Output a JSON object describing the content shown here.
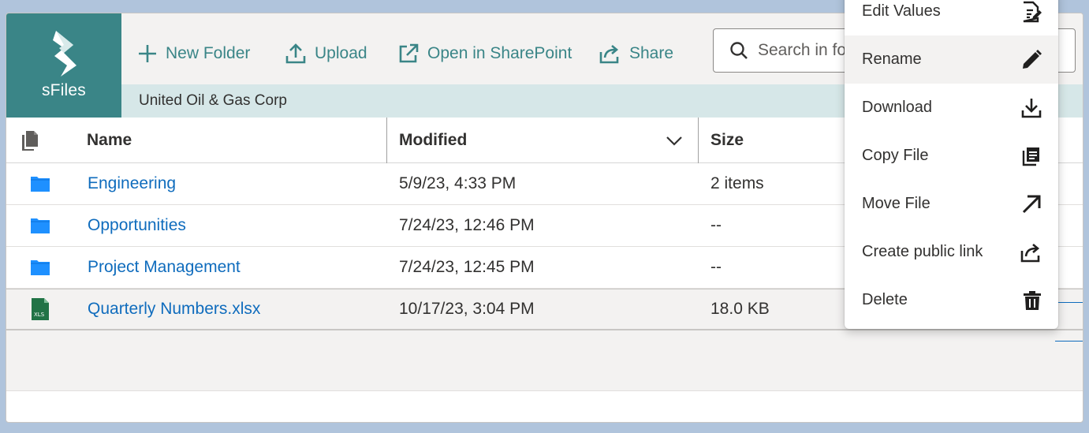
{
  "app": {
    "logo_text": "sFiles"
  },
  "toolbar": {
    "new_folder": "New Folder",
    "upload": "Upload",
    "open_sharepoint": "Open in SharePoint",
    "share": "Share"
  },
  "search": {
    "placeholder": "Search in folder"
  },
  "breadcrumb": {
    "path": "United Oil & Gas Corp"
  },
  "columns": {
    "name": "Name",
    "modified": "Modified",
    "size": "Size"
  },
  "rows": [
    {
      "type": "folder",
      "name": "Engineering",
      "modified": "5/9/23, 4:33 PM",
      "size": "2 items"
    },
    {
      "type": "folder",
      "name": "Opportunities",
      "modified": "7/24/23, 12:46 PM",
      "size": "--"
    },
    {
      "type": "folder",
      "name": "Project Management",
      "modified": "7/24/23, 12:45 PM",
      "size": "--"
    },
    {
      "type": "xlsx",
      "name": "Quarterly Numbers.xlsx",
      "modified": "10/17/23, 3:04 PM",
      "size": "18.0 KB",
      "file_badge": "XLS"
    }
  ],
  "context_menu": {
    "items": [
      {
        "label": "Edit Values",
        "icon": "edit-values-icon"
      },
      {
        "label": "Rename",
        "icon": "pencil-icon"
      },
      {
        "label": "Download",
        "icon": "download-icon"
      },
      {
        "label": "Copy File",
        "icon": "copy-icon"
      },
      {
        "label": "Move File",
        "icon": "arrow-up-right-icon"
      },
      {
        "label": "Create public link",
        "icon": "share-icon"
      },
      {
        "label": "Delete",
        "icon": "trash-icon"
      }
    ]
  },
  "colors": {
    "brand": "#3a8587",
    "link": "#0f6cbd",
    "folder": "#1e90ff",
    "excel": "#217346"
  }
}
